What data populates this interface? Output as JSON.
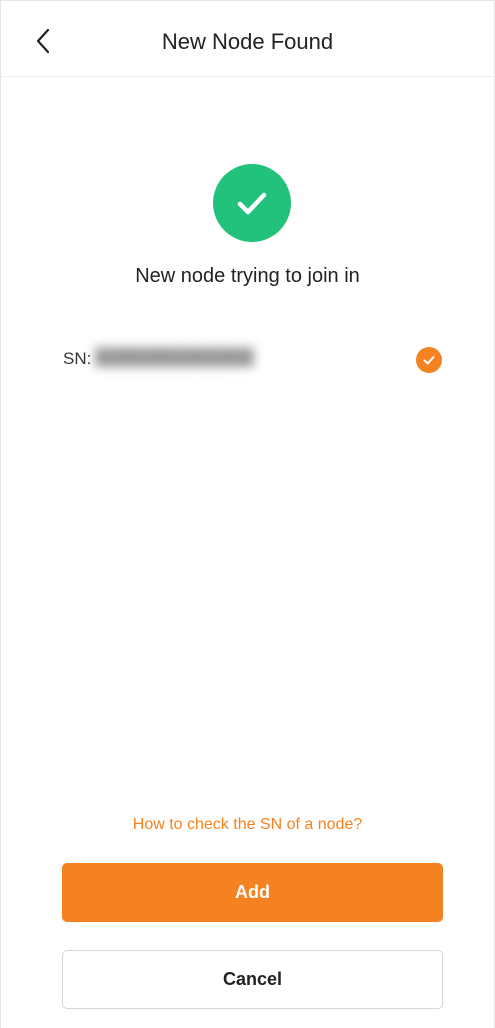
{
  "header": {
    "title": "New Node Found",
    "back_icon": "chevron-left-icon"
  },
  "status": {
    "icon": "success-check-icon",
    "color": "#22c17c",
    "message": "New node trying to join in"
  },
  "node": {
    "sn_label": "SN:",
    "sn_value": "██████████████",
    "selected": true,
    "check_color": "#f58220"
  },
  "help_link": "How to check the SN of a node?",
  "actions": {
    "add_label": "Add",
    "cancel_label": "Cancel",
    "accent_color": "#f58220"
  }
}
